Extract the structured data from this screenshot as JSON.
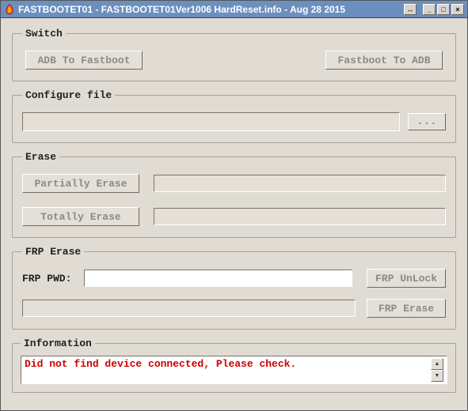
{
  "window": {
    "title": "FASTBOOTET01 - FASTBOOTET01Ver1006  HardReset.info - Aug 28 2015",
    "titlebar_btns": {
      "pin": "↔",
      "min": "_",
      "max": "□",
      "close": "×"
    }
  },
  "switch": {
    "legend": "Switch",
    "adb_to_fastboot": "ADB To Fastboot",
    "fastboot_to_adb": "Fastboot To ADB"
  },
  "config": {
    "legend": "Configure file",
    "path": "",
    "browse": "..."
  },
  "erase": {
    "legend": "Erase",
    "partial": "Partially Erase",
    "partial_status": "",
    "total": "Totally Erase",
    "total_status": ""
  },
  "frp": {
    "legend": "FRP Erase",
    "pwd_label": "FRP PWD:",
    "pwd_value": "",
    "unlock": "FRP UnLock",
    "erase": "FRP Erase",
    "status": ""
  },
  "info": {
    "legend": "Information",
    "text": "Did not find device connected, Please check."
  }
}
